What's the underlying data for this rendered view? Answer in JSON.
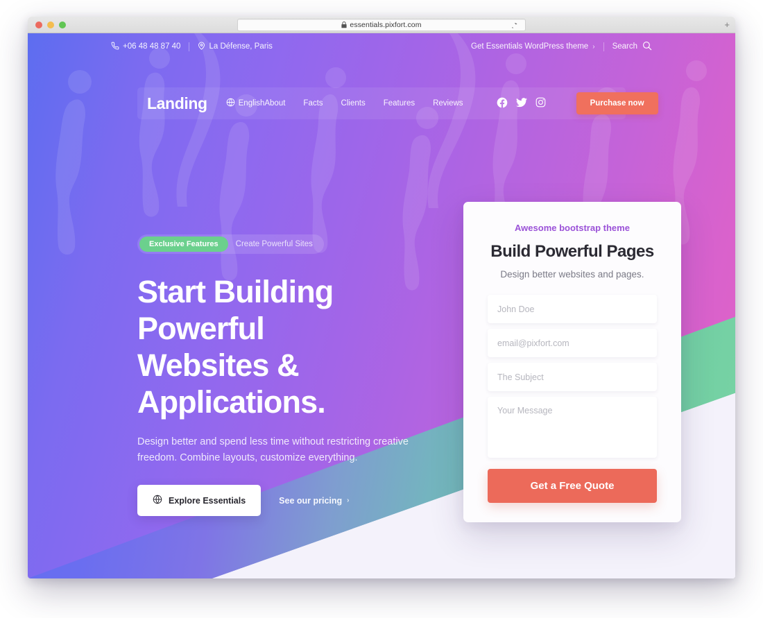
{
  "browser": {
    "url": "essentials.pixfort.com",
    "lock_icon": "lock-icon",
    "reload_icon": "reload-icon",
    "newtab_label": "+",
    "traffic_lights": [
      "close",
      "minimize",
      "maximize"
    ]
  },
  "topbar": {
    "phone": "+06 48 48 87 40",
    "phone_icon": "phone-icon",
    "location": "La Défense, Paris",
    "location_icon": "map-pin-icon",
    "promo_link": "Get Essentials WordPress theme",
    "promo_chevron": "›",
    "search_label": "Search",
    "search_icon": "search-icon"
  },
  "nav": {
    "logo": "Landing",
    "language": "English",
    "language_icon": "globe-icon",
    "menu": [
      {
        "label": "About"
      },
      {
        "label": "Facts"
      },
      {
        "label": "Clients"
      },
      {
        "label": "Features"
      },
      {
        "label": "Reviews"
      }
    ],
    "socials": [
      {
        "name": "facebook-icon"
      },
      {
        "name": "twitter-icon"
      },
      {
        "name": "instagram-icon"
      }
    ],
    "cta_label": "Purchase now",
    "cta_color": "#f0705d"
  },
  "hero": {
    "badge_pill": "Exclusive Features",
    "badge_pill_color": "#6bd08d",
    "badge_text": "Create Powerful Sites",
    "title_line1": "Start Building Powerful",
    "title_line2": "Websites & Applications.",
    "subtitle": "Design better and spend less time without restricting creative freedom. Combine layouts, customize everything.",
    "primary_button": "Explore Essentials",
    "primary_button_icon": "globe-icon",
    "secondary_link": "See our pricing",
    "secondary_chevron": "›"
  },
  "form": {
    "eyebrow": "Awesome bootstrap theme",
    "eyebrow_color": "#9b52d8",
    "title": "Build Powerful Pages",
    "subtitle": "Design better websites and pages.",
    "name_placeholder": "John Doe",
    "name_value": "",
    "email_placeholder": "email@pixfort.com",
    "email_value": "",
    "subject_placeholder": "The Subject",
    "subject_value": "",
    "message_placeholder": "Your Message",
    "message_value": "",
    "submit_label": "Get a Free Quote",
    "submit_color": "#ec6a5a"
  },
  "theme": {
    "gradient_start": "#5d6df0",
    "gradient_end": "#e463c4",
    "band_green": "#72cfa4",
    "bottom_bg": "#f4f2fb"
  }
}
